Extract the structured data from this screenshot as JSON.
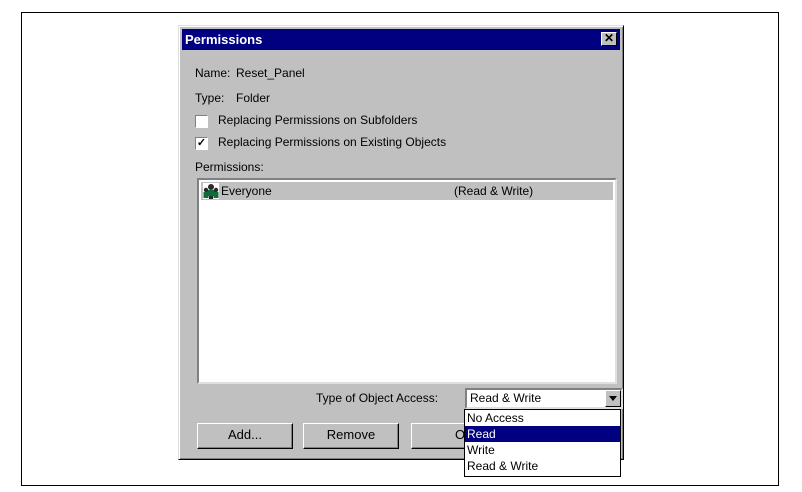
{
  "dialog": {
    "title": "Permissions",
    "close_label": "✕",
    "name_label": "Name:",
    "name_value": "Reset_Panel",
    "type_label": "Type:",
    "type_value": "Folder",
    "checkbox_subfolders": {
      "label": "Replacing Permissions on Subfolders",
      "checked": false
    },
    "checkbox_existing": {
      "label": "Replacing Permissions on Existing Objects",
      "checked": true
    },
    "permissions_label": "Permissions:",
    "permissions": [
      {
        "name": "Everyone",
        "access": "(Read & Write)",
        "icon": "group-icon"
      }
    ],
    "access_label": "Type of Object Access:",
    "access_value": "Read & Write",
    "access_options": [
      "No Access",
      "Read",
      "Write",
      "Read & Write"
    ],
    "highlighted_option": "Read",
    "buttons": {
      "add": "Add...",
      "remove": "Remove",
      "ok": "OK"
    }
  },
  "colors": {
    "titlebar": "#000080",
    "dialog_bg": "#c0c0c0",
    "selection": "#000080"
  }
}
